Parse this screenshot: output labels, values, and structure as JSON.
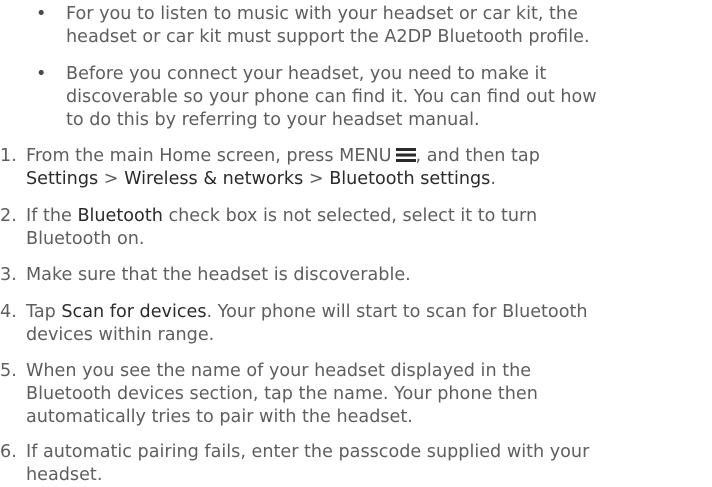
{
  "bullets": [
    {
      "marker": "•",
      "lines": [
        "For you to listen to music with your headset or car kit, the",
        "headset or car kit must support the A2DP Bluetooth profile."
      ]
    },
    {
      "marker": "•",
      "lines": [
        "Before you connect your headset, you need to make it",
        "discoverable so your phone can find it. You can find out how",
        "to do this by referring to your headset manual."
      ]
    }
  ],
  "steps": [
    {
      "num": "1.",
      "l1_pre": "From the main Home screen, press MENU",
      "l1_post": ", and then tap",
      "menu_icon": "menu-icon",
      "l2_a": "Settings",
      "l2_sep1": " > ",
      "l2_b": "Wireless & networks",
      "l2_sep2": " > ",
      "l2_c": "Bluetooth settings",
      "l2_end": "."
    },
    {
      "num": "2.",
      "l1_pre": "If the ",
      "l1_bold": "Bluetooth",
      "l1_post": " check box is not selected, select it to turn",
      "l2": "Bluetooth on."
    },
    {
      "num": "3.",
      "l1": "Make sure that the headset is discoverable."
    },
    {
      "num": "4.",
      "l1_pre": "Tap ",
      "l1_bold": "Scan for devices",
      "l1_post": ". Your phone will start to scan for Bluetooth",
      "l2": "devices within range."
    },
    {
      "num": "5.",
      "lines": [
        "When you see the name of your headset displayed in the",
        "Bluetooth devices section, tap the name. Your phone then",
        "automatically tries to pair with the headset."
      ]
    },
    {
      "num": "6.",
      "lines": [
        "If automatic pairing fails, enter the passcode supplied with your",
        "headset."
      ]
    }
  ],
  "colors": {
    "text": "#5e5e5e",
    "emphasis": "#2a2a2a"
  }
}
